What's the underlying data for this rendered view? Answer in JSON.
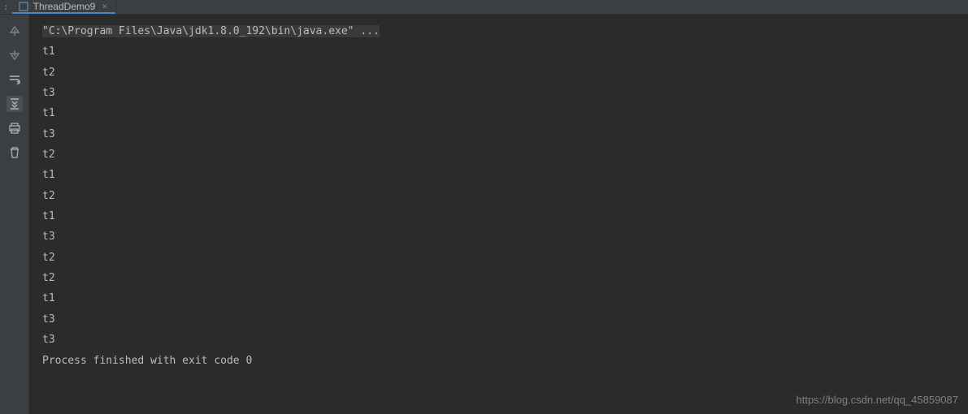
{
  "tab": {
    "title": "ThreadDemo9"
  },
  "console": {
    "command_line": "\"C:\\Program Files\\Java\\jdk1.8.0_192\\bin\\java.exe\" ...",
    "lines": [
      "t1",
      "t2",
      "t3",
      "t1",
      "t3",
      "t2",
      "t1",
      "t2",
      "t1",
      "t3",
      "t2",
      "t2",
      "t1",
      "t3",
      "t3"
    ],
    "exit_message": "Process finished with exit code 0"
  },
  "watermark": "https://blog.csdn.net/qq_45859087",
  "toolbar": {
    "icons": [
      "arrow-up",
      "arrow-down",
      "soft-wrap",
      "scroll-to-end",
      "print",
      "trash"
    ]
  }
}
